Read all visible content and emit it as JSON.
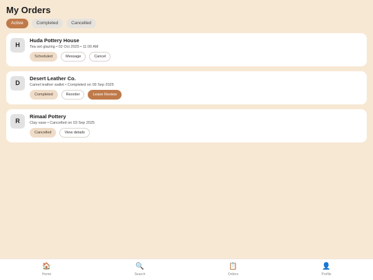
{
  "header": {
    "title": "My Orders"
  },
  "filters": [
    {
      "label": "Active"
    },
    {
      "label": "Completed"
    },
    {
      "label": "Cancelled"
    }
  ],
  "orders": [
    {
      "initial": "H",
      "name": "Huda Pottery House",
      "details": "Tea set glazing • 02 Oct 2025 • 11:00 AM",
      "status": "Scheduled",
      "actions": [
        "Message",
        "Cancel"
      ]
    },
    {
      "initial": "D",
      "name": "Desert Leather Co.",
      "details": "Camel leather wallet • Completed on 09 Sep 2025",
      "status": "Completed",
      "actions": [
        "Reorder",
        "Leave Review"
      ]
    },
    {
      "initial": "R",
      "name": "Rimaal Pottery",
      "details": "Clay vase • Cancelled on 03 Sep 2025",
      "status": "Cancelled",
      "actions": [
        "View details"
      ]
    }
  ],
  "nav": [
    {
      "icon": "🏠",
      "icon_name": "home-icon",
      "label": "Home"
    },
    {
      "icon": "🔍",
      "icon_name": "search-icon",
      "label": "Search"
    },
    {
      "icon": "📋",
      "icon_name": "orders-icon",
      "label": "Orders"
    },
    {
      "icon": "👤",
      "icon_name": "profile-icon",
      "label": "Profile"
    }
  ],
  "colors": {
    "background": "#f7e8d4",
    "accent": "#c07a4a",
    "status_chip": "#efdcc8"
  }
}
